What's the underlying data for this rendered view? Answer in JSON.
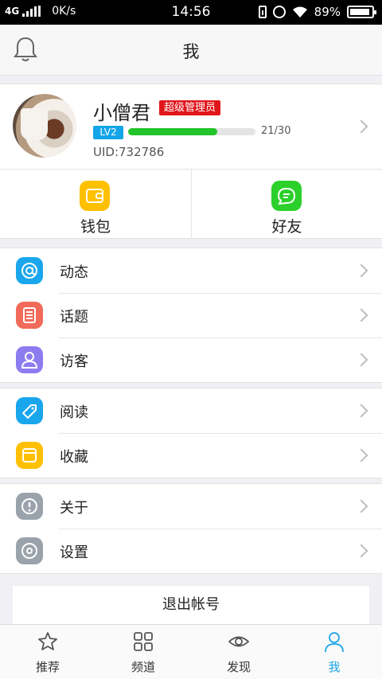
{
  "status_bar": {
    "network": "4G",
    "speed": "0K/s",
    "time": "14:56",
    "battery": "89%"
  },
  "header": {
    "title": "我",
    "bell_icon": "bell-icon"
  },
  "profile": {
    "name": "小僧君",
    "badge": "超级管理员",
    "level": "LV2",
    "exp_text": "21/30",
    "exp_progress": 0.7,
    "uid": "UID:732786"
  },
  "quick": [
    {
      "label": "钱包",
      "icon": "wallet-icon",
      "color": "#ffc000"
    },
    {
      "label": "好友",
      "icon": "chat-icon",
      "color": "#2bd02b"
    }
  ],
  "menu_groups": [
    [
      {
        "label": "动态",
        "icon": "at-icon",
        "color": "#19a6ec"
      },
      {
        "label": "话题",
        "icon": "list-icon",
        "color": "#f16a5a"
      },
      {
        "label": "访客",
        "icon": "person-icon",
        "color": "#8d7cf0"
      }
    ],
    [
      {
        "label": "阅读",
        "icon": "tag-icon",
        "color": "#19a6ec"
      },
      {
        "label": "收藏",
        "icon": "bookmark-icon",
        "color": "#ffc000"
      }
    ],
    [
      {
        "label": "关于",
        "icon": "info-icon",
        "color": "#9aa3ab"
      },
      {
        "label": "设置",
        "icon": "settings-icon",
        "color": "#9aa3ab"
      }
    ]
  ],
  "logout_label": "退出帐号",
  "tabs": [
    {
      "label": "推荐",
      "icon": "star-icon"
    },
    {
      "label": "频道",
      "icon": "grid-icon"
    },
    {
      "label": "发现",
      "icon": "eye-icon"
    },
    {
      "label": "我",
      "icon": "user-icon",
      "active": true
    }
  ],
  "colors": {
    "accent": "#1aa3e8",
    "progress": "#21c42a",
    "badge": "#e0161b"
  }
}
